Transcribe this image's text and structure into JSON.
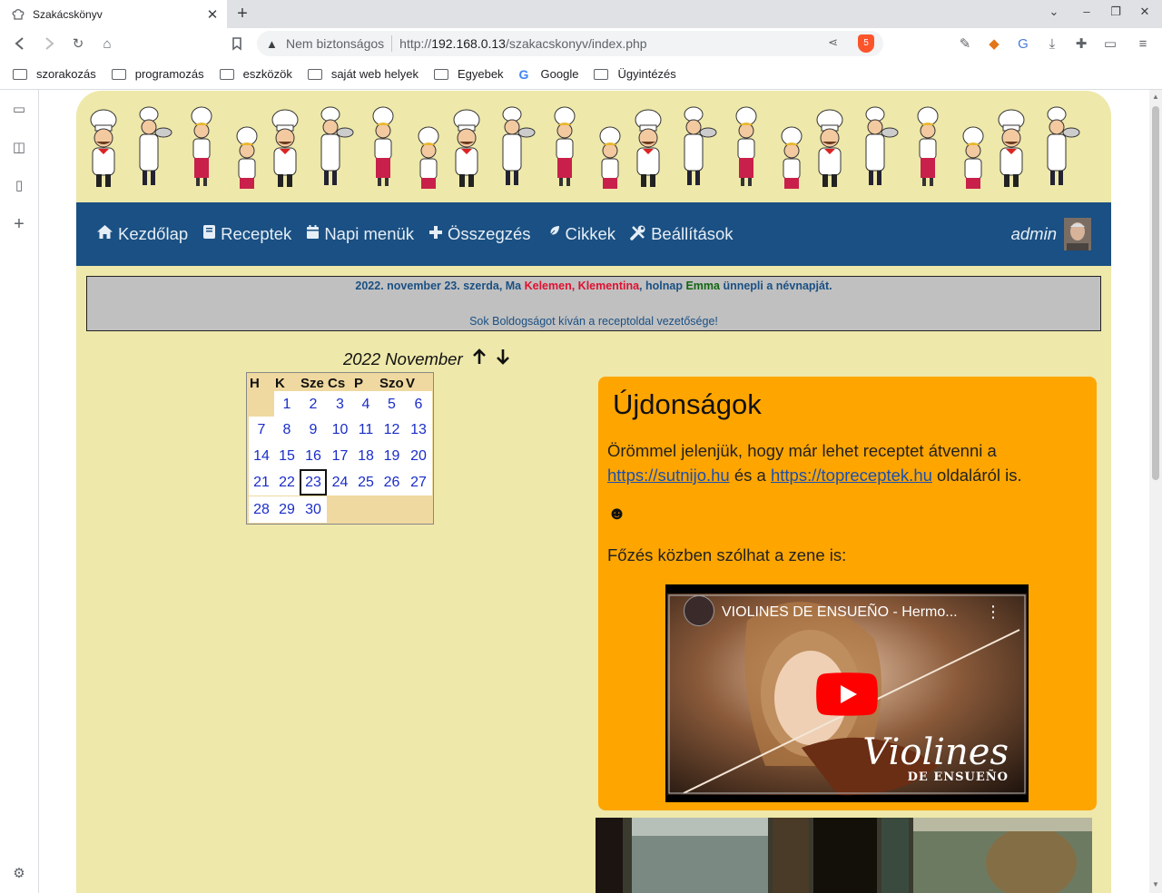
{
  "browser": {
    "tab_title": "Szakácskönyv",
    "omnibox": {
      "security_label": "Nem biztonságos",
      "url_prefix": "http://",
      "url_host": "192.168.0.13",
      "url_path": "/szakacskonyv/index.php"
    },
    "shield_count": "5",
    "bookmarks": [
      {
        "label": "szorakozás",
        "icon": "folder-icon"
      },
      {
        "label": "programozás",
        "icon": "folder-icon"
      },
      {
        "label": "eszközök",
        "icon": "folder-icon"
      },
      {
        "label": "saját web helyek",
        "icon": "folder-icon"
      },
      {
        "label": "Egyebek",
        "icon": "folder-icon"
      },
      {
        "label": "Google",
        "icon": "google-icon"
      },
      {
        "label": "Ügyintézés",
        "icon": "folder-icon"
      }
    ]
  },
  "site": {
    "nav": [
      {
        "label": "Kezdőlap",
        "icon": "home-icon"
      },
      {
        "label": "Receptek",
        "icon": "book-icon"
      },
      {
        "label": "Napi menük",
        "icon": "calendar-icon"
      },
      {
        "label": "Összegzés",
        "icon": "plus-icon"
      },
      {
        "label": "Cikkek",
        "icon": "feather-icon"
      },
      {
        "label": "Beállítások",
        "icon": "tools-icon"
      }
    ],
    "user": {
      "name": "admin"
    },
    "notice": {
      "date_text": "2022. november 23. szerda, Ma ",
      "name1": "Kelemen, Klementina",
      "middle_text": ", holnap ",
      "name2": "Emma",
      "end_text": " ünnepli a névnapját.",
      "greeting": "Sok Boldogságot kíván a receptoldal vezetősége!"
    },
    "calendar": {
      "heading": "2022 November",
      "weekdays": [
        "H",
        "K",
        "Sze",
        "Cs",
        "P",
        "Szo",
        "V"
      ],
      "weeks": [
        [
          "",
          "1",
          "2",
          "3",
          "4",
          "5",
          "6"
        ],
        [
          "7",
          "8",
          "9",
          "10",
          "11",
          "12",
          "13"
        ],
        [
          "14",
          "15",
          "16",
          "17",
          "18",
          "19",
          "20"
        ],
        [
          "21",
          "22",
          "23",
          "24",
          "25",
          "26",
          "27"
        ],
        [
          "28",
          "29",
          "30",
          "",
          "",
          "",
          ""
        ]
      ],
      "today": "23"
    },
    "news": {
      "title": "Újdonságok",
      "text_before": "Örömmel jelenjük, hogy már lehet receptet átvenni a ",
      "link1": "https://sutnijo.hu",
      "text_mid": " és a ",
      "link2": "https://topreceptek.hu",
      "text_after": " oldaláról is.",
      "smiley": "☻",
      "music_text": "Főzés közben szólhat a zene is:",
      "video": {
        "title": "VIOLINES DE ENSUEÑO - Hermo...",
        "brand": "Violines",
        "brand_sub": "DE ENSUEÑO"
      }
    }
  },
  "colors": {
    "page_bg": "#eee8aa",
    "nav_bg": "#1a5083",
    "news_bg": "#ffa500",
    "link": "#1a2dc8"
  }
}
